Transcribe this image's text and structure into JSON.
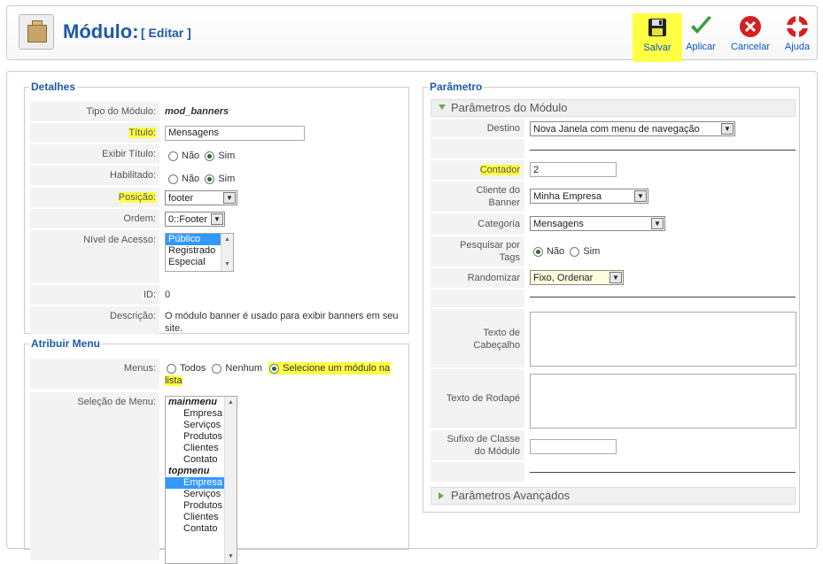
{
  "header": {
    "title": "Módulo:",
    "subtitle": "[ Editar ]",
    "buttons": {
      "save": "Salvar",
      "apply": "Aplicar",
      "cancel": "Cancelar",
      "help": "Ajuda"
    }
  },
  "details": {
    "legend": "Detalhes",
    "module_type_label": "Tipo do Módulo:",
    "module_type_value": "mod_banners",
    "title_label": "Título:",
    "title_value": "Mensagens",
    "show_title_label": "Exibir Título:",
    "show_title_options": [
      "Não",
      "Sim"
    ],
    "show_title_selected": "Sim",
    "enabled_label": "Habilitado:",
    "enabled_options": [
      "Não",
      "Sim"
    ],
    "enabled_selected": "Sim",
    "position_label": "Posição:",
    "position_value": "footer",
    "order_label": "Ordem:",
    "order_value": "0::Footer",
    "access_label": "Nível de Acesso:",
    "access_options": [
      "Público",
      "Registrado",
      "Especial"
    ],
    "access_selected": "Público",
    "id_label": "ID:",
    "id_value": "0",
    "description_label": "Descrição:",
    "description_line1": "O módulo banner é usado para exibir banners em seu",
    "description_line2": "site."
  },
  "menu_assign": {
    "legend": "Atribuir Menu",
    "menus_label": "Menus:",
    "menus_options": [
      "Todos",
      "Nenhum",
      "Selecione um módulo na"
    ],
    "menus_option3_cont": "lista",
    "menus_selected": "Selecione um módulo na lista",
    "selection_label": "Seleção de Menu:",
    "groups": [
      {
        "name": "mainmenu",
        "items": [
          "Empresa",
          "Serviços",
          "Produtos",
          "Clientes",
          "Contato"
        ]
      },
      {
        "name": "topmenu",
        "items": [
          "Empresa",
          "Serviços",
          "Produtos",
          "Clientes",
          "Contato"
        ]
      }
    ],
    "selected_item": "topmenu/Empresa"
  },
  "params": {
    "legend": "Parâmetro",
    "module_params_header": "Parâmetros do Módulo",
    "target_label": "Destino",
    "target_value": "Nova Janela com menu de navegação",
    "counter_label": "Contador",
    "counter_value": "2",
    "client_label_1": "Cliente do",
    "client_label_2": "Banner",
    "client_value": "Minha Empresa",
    "category_label": "Categoria",
    "category_value": "Mensagens",
    "tags_label_1": "Pesquisar por",
    "tags_label_2": "Tags",
    "tags_options": [
      "Não",
      "Sim"
    ],
    "tags_selected": "Não",
    "random_label": "Randomizar",
    "random_value": "Fixo, Ordenar",
    "header_text_label_1": "Texto de",
    "header_text_label_2": "Cabeçalho",
    "footer_text_label": "Texto de Rodapé",
    "suffix_label_1": "Sufixo de Classe",
    "suffix_label_2": "do Módulo",
    "advanced_params_header": "Parâmetros Avançados"
  }
}
